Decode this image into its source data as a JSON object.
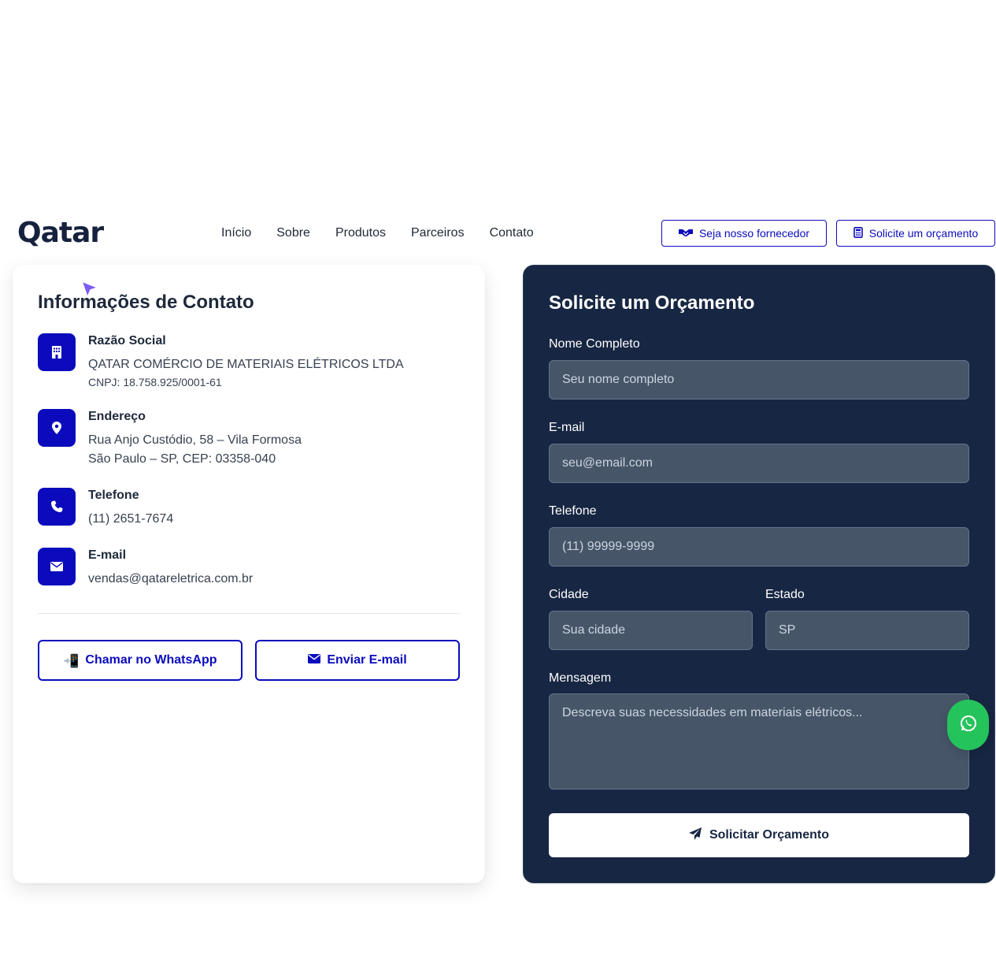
{
  "header": {
    "logo_text": "Qatar",
    "nav": [
      "Início",
      "Sobre",
      "Produtos",
      "Parceiros",
      "Contato"
    ],
    "supplier_button": "Seja nosso fornecedor",
    "quote_button": "Solicite um orçamento"
  },
  "contact": {
    "title": "Informações de Contato",
    "company": {
      "label": "Razão Social",
      "name": "QATAR COMÉRCIO DE MATERIAIS ELÉTRICOS LTDA",
      "cnpj": "CNPJ: 18.758.925/0001-61"
    },
    "address": {
      "label": "Endereço",
      "line1": "Rua Anjo Custódio, 58 – Vila Formosa",
      "line2": "São Paulo – SP, CEP: 03358-040"
    },
    "phone": {
      "label": "Telefone",
      "value": "(11) 2651-7674"
    },
    "email": {
      "label": "E-mail",
      "value": "vendas@qatareletrica.com.br"
    },
    "whatsapp_button": "Chamar no WhatsApp",
    "email_button": "Enviar E-mail",
    "whatsapp_emoji": "📲"
  },
  "form": {
    "title": "Solicite um Orçamento",
    "name_label": "Nome Completo",
    "name_placeholder": "Seu nome completo",
    "email_label": "E-mail",
    "email_placeholder": "seu@email.com",
    "phone_label": "Telefone",
    "phone_placeholder": "(11) 99999-9999",
    "city_label": "Cidade",
    "city_placeholder": "Sua cidade",
    "state_label": "Estado",
    "state_placeholder": "SP",
    "message_label": "Mensagem",
    "message_placeholder": "Descreva suas necessidades em materiais elétricos...",
    "submit_button": "Solicitar Orçamento"
  },
  "colors": {
    "primary": "#0b0bbd",
    "navy": "#172642",
    "whatsapp": "#25c35c"
  }
}
